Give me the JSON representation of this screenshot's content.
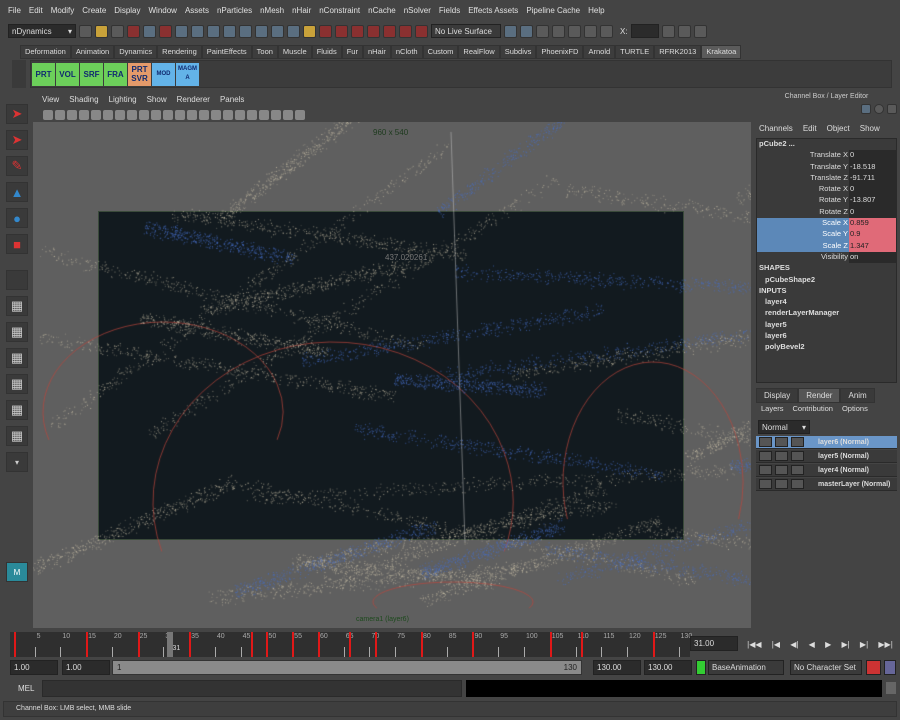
{
  "menubar": [
    "File",
    "Edit",
    "Modify",
    "Create",
    "Display",
    "Window",
    "Assets",
    "nParticles",
    "nMesh",
    "nHair",
    "nConstraint",
    "nCache",
    "nSolver",
    "Fields",
    "Effects Assets",
    "Pipeline Cache",
    "Help"
  ],
  "status": {
    "menu_set": "nDynamics",
    "live_surface": "No Live Surface",
    "x_label": "X:"
  },
  "shelf_tabs": [
    "Deformation",
    "Animation",
    "Dynamics",
    "Rendering",
    "PaintEffects",
    "Toon",
    "Muscle",
    "Fluids",
    "Fur",
    "nHair",
    "nCloth",
    "Custom",
    "RealFlow",
    "Subdivs",
    "PhoenixFD",
    "Arnold",
    "TURTLE",
    "RFRK2013",
    "Krakatoa"
  ],
  "active_shelf": "Krakatoa",
  "shelf_buttons": [
    {
      "label": "PRT",
      "color": "green"
    },
    {
      "label": "VOL",
      "color": "green"
    },
    {
      "label": "SRF",
      "color": "green"
    },
    {
      "label": "FRA",
      "color": "green"
    },
    {
      "label": "PRT SVR",
      "color": "orange"
    },
    {
      "label": "MOD",
      "color": "blue"
    },
    {
      "label": "MAGMA",
      "color": "blue"
    }
  ],
  "panel_menu": [
    "View",
    "Shading",
    "Lighting",
    "Show",
    "Renderer",
    "Panels"
  ],
  "viewport": {
    "resolution": "960 x 540",
    "camera": "camera1 (layer6)",
    "distance": "437.020261"
  },
  "right_panel": {
    "title": "Channel Box / Layer Editor",
    "cb_menu": [
      "Channels",
      "Edit",
      "Object",
      "Show"
    ],
    "object": "pCube2 ...",
    "channels": [
      {
        "name": "Translate X",
        "value": "0",
        "selected": false
      },
      {
        "name": "Translate Y",
        "value": "-18.518",
        "selected": false
      },
      {
        "name": "Translate Z",
        "value": "-91.711",
        "selected": false
      },
      {
        "name": "Rotate X",
        "value": "0",
        "selected": false
      },
      {
        "name": "Rotate Y",
        "value": "-13.807",
        "selected": false
      },
      {
        "name": "Rotate Z",
        "value": "0",
        "selected": false
      },
      {
        "name": "Scale X",
        "value": "0.859",
        "selected": true
      },
      {
        "name": "Scale Y",
        "value": "0.9",
        "selected": true
      },
      {
        "name": "Scale Z",
        "value": "1.347",
        "selected": true
      },
      {
        "name": "Visibility",
        "value": "on",
        "selected": false
      }
    ],
    "shapes_label": "SHAPES",
    "shapes": [
      "pCubeShape2"
    ],
    "inputs_label": "INPUTS",
    "inputs": [
      "layer4",
      "renderLayerManager",
      "layer5",
      "layer6",
      "polyBevel2"
    ],
    "le_tabs": [
      "Display",
      "Render",
      "Anim"
    ],
    "le_active": "Render",
    "le_menu": [
      "Layers",
      "Contribution",
      "Options"
    ],
    "blend_mode": "Normal",
    "layers": [
      {
        "name": "layer6 (Normal)",
        "active": true
      },
      {
        "name": "layer5 (Normal)",
        "active": false
      },
      {
        "name": "layer4 (Normal)",
        "active": false
      },
      {
        "name": "masterLayer (Normal)",
        "active": false
      }
    ]
  },
  "timeline": {
    "start": 1,
    "end": 130,
    "current_frame": 31,
    "current_frame_text": "31.00",
    "current_label": "31",
    "ticks": [
      5,
      10,
      15,
      20,
      25,
      30,
      35,
      40,
      45,
      50,
      55,
      60,
      65,
      70,
      75,
      80,
      85,
      90,
      95,
      100,
      105,
      110,
      115,
      120,
      125,
      130
    ],
    "keys": [
      1,
      15,
      25,
      35,
      47,
      50,
      55,
      60,
      66,
      71,
      80,
      90,
      105,
      111,
      125
    ]
  },
  "range": {
    "start": "1.00",
    "playback_start": "1.00",
    "slider_start": "1",
    "slider_end": "130",
    "playback_end": "130.00",
    "end": "130.00",
    "anim_layer": "BaseAnimation",
    "character_set": "No Character Set"
  },
  "mel_label": "MEL",
  "help_line": "Channel Box: LMB select, MMB slide",
  "colors": {
    "selected_label": "#5c88b8",
    "selected_value": "#e06a78",
    "key": "#e01818"
  }
}
